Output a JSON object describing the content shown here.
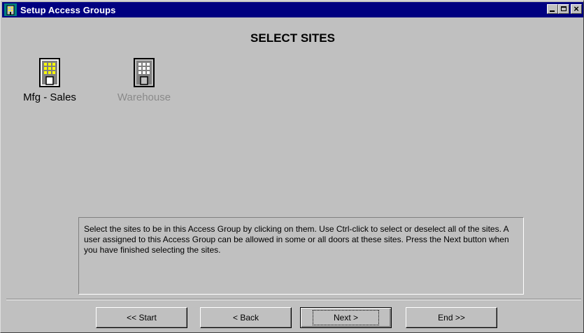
{
  "window": {
    "title": "Setup Access Groups",
    "icon": "building-app-icon",
    "controls": [
      "minimize",
      "maximize",
      "close"
    ]
  },
  "page": {
    "title": "SELECT SITES"
  },
  "sites": [
    {
      "label": "Mfg - Sales",
      "icon": "building-icon",
      "selected": true
    },
    {
      "label": "Warehouse",
      "icon": "building-icon",
      "selected": false
    }
  ],
  "instructions": "Select the sites to be in this Access Group by clicking on them.  Use Ctrl-click to select or deselect all of the sites.  A user assigned to this Access Group can be allowed in some or all doors at these sites.  Press the Next button when you have finished selecting the sites.",
  "buttons": {
    "start": "<< Start",
    "back": "< Back",
    "next": "Next >",
    "end": "End >>"
  },
  "colors": {
    "titlebar": "#000080",
    "face": "#c0c0c0",
    "disabled_text": "#8a8a8a"
  }
}
